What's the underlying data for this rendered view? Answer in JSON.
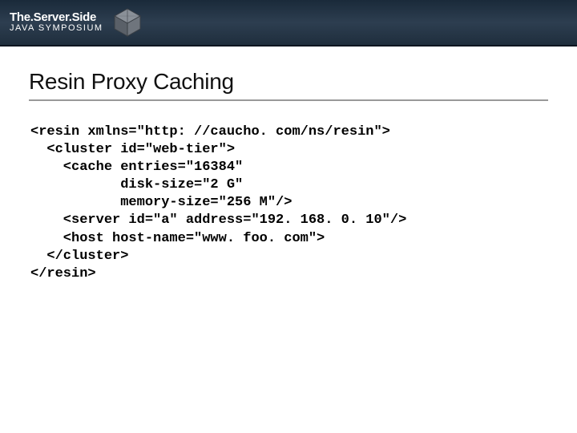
{
  "header": {
    "logo_line1": "The.Server.Side",
    "logo_line2": "JAVA SYMPOSIUM"
  },
  "slide": {
    "title": "Resin Proxy Caching",
    "code": "<resin xmlns=\"http: //caucho. com/ns/resin\">\n  <cluster id=\"web-tier\">\n    <cache entries=\"16384\"\n           disk-size=\"2 G\"\n           memory-size=\"256 M\"/>\n    <server id=\"a\" address=\"192. 168. 0. 10\"/>\n    <host host-name=\"www. foo. com\">\n  </cluster>\n</resin>"
  }
}
